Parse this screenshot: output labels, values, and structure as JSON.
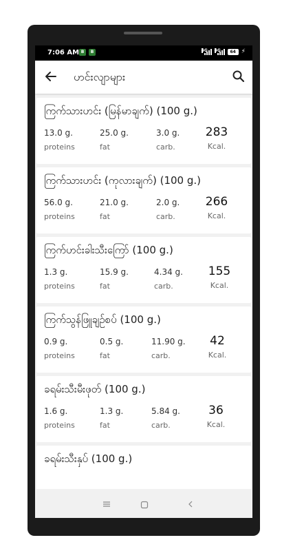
{
  "status_bar": {
    "time": "7:06 AM",
    "notif_1": "B",
    "notif_2": "B",
    "sig_1": "4G",
    "sig_2": "4G",
    "battery": "64"
  },
  "app_bar": {
    "back_icon": "arrow-left-icon",
    "title": "ဟင်းလျာများ",
    "search_icon": "search-icon"
  },
  "labels": {
    "proteins": "proteins",
    "fat": "fat",
    "carb": "carb.",
    "kcal": "Kcal."
  },
  "foods": [
    {
      "name": "ကြက်သားဟင်း (မြန်မာချက်) (100 g.)",
      "protein": "13.0 g.",
      "fat": "25.0 g.",
      "carb": "3.0 g.",
      "kcal": "283"
    },
    {
      "name": "ကြက်သားဟင်း (ကုလားချက်) (100 g.)",
      "protein": "56.0 g.",
      "fat": "21.0 g.",
      "carb": "2.0 g.",
      "kcal": "266"
    },
    {
      "name": "ကြက်ဟင်းခါးသီးကြော် (100 g.)",
      "protein": "1.3 g.",
      "fat": "15.9 g.",
      "carb": "4.34 g.",
      "kcal": "155"
    },
    {
      "name": "ကြက်သွန်ဖြူချဉ်စပ် (100 g.)",
      "protein": "0.9 g.",
      "fat": "0.5 g.",
      "carb": "11.90 g.",
      "kcal": "42"
    },
    {
      "name": "ခရမ်းသီးမီးဖုတ် (100 g.)",
      "protein": "1.6 g.",
      "fat": "1.3 g.",
      "carb": "5.84 g.",
      "kcal": "36"
    },
    {
      "name": "ခရမ်းသီးနှပ် (100 g.)"
    }
  ],
  "nav_bar": {
    "recent_icon": "menu-icon",
    "home_icon": "square-icon",
    "back_icon": "chevron-left-icon"
  }
}
